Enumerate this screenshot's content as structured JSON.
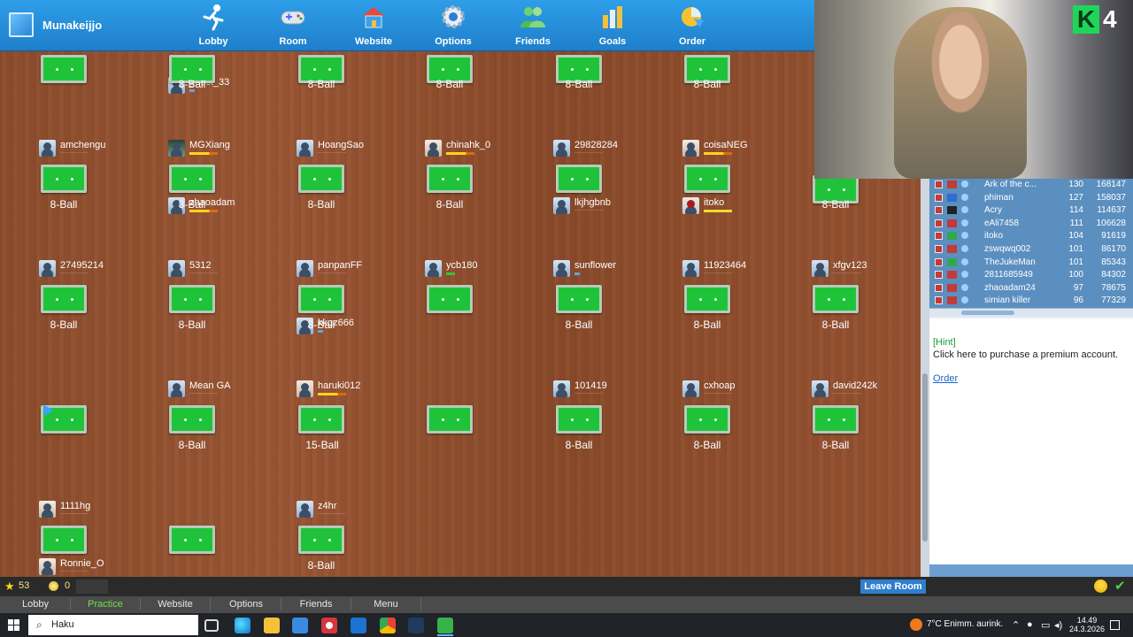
{
  "app": {
    "name": "Munakeijjo"
  },
  "toolbar": [
    {
      "key": "lobby",
      "label": "Lobby",
      "icon": "runner-icon"
    },
    {
      "key": "room",
      "label": "Room",
      "icon": "gamepad-icon"
    },
    {
      "key": "website",
      "label": "Website",
      "icon": "house-icon"
    },
    {
      "key": "options",
      "label": "Options",
      "icon": "gear-icon"
    },
    {
      "key": "friends",
      "label": "Friends",
      "icon": "people-icon"
    },
    {
      "key": "goals",
      "label": "Goals",
      "icon": "bar-chart-icon"
    },
    {
      "key": "order",
      "label": "Order",
      "icon": "pie-chart-icon"
    }
  ],
  "room": {
    "players": [
      {
        "name": "guest_33",
        "bar": "blue"
      },
      {
        "name": "amchengu",
        "bar": "faint"
      },
      {
        "name": "MGXiang",
        "bar": "gold",
        "avatar": "dark"
      },
      {
        "name": "HoangSao",
        "bar": "faint"
      },
      {
        "name": "chinahk_0",
        "bar": "gold",
        "avatar": "photo"
      },
      {
        "name": "29828284",
        "bar": "faint"
      },
      {
        "name": "coisaNEG",
        "bar": "gold",
        "avatar": "photo"
      },
      {
        "name": "zhaoadam",
        "bar": "gold"
      },
      {
        "name": "lkjhgbnb",
        "bar": "faint"
      },
      {
        "name": "itoko",
        "bar": "yellow",
        "avatar": "red"
      },
      {
        "name": "27495214",
        "bar": "faint"
      },
      {
        "name": "5312",
        "bar": "faint"
      },
      {
        "name": "panpanFF",
        "bar": "faint"
      },
      {
        "name": "ycb180",
        "bar": "green"
      },
      {
        "name": "sunflower",
        "bar": "blue"
      },
      {
        "name": "11923464",
        "bar": "faint"
      },
      {
        "name": "xfgv123",
        "bar": "faint"
      },
      {
        "name": "kkgz666",
        "bar": "blue"
      },
      {
        "name": "Mean GA",
        "bar": "faint"
      },
      {
        "name": "haruki012",
        "bar": "gold",
        "avatar": "photo"
      },
      {
        "name": "101419",
        "bar": "faint"
      },
      {
        "name": "cxhoap",
        "bar": "faint"
      },
      {
        "name": "david242k",
        "bar": "faint"
      },
      {
        "name": "1111hg",
        "bar": "faint",
        "avatar": "photo"
      },
      {
        "name": "z4hr",
        "bar": "faint"
      },
      {
        "name": "Ronnie_O",
        "bar": "faint",
        "avatar": "photo"
      }
    ],
    "table_labels": [
      "8-Ball",
      "8-Ball",
      "8-Ball",
      "8-Ball",
      "8-Ball",
      "8-Ball",
      "8-Ball",
      "8-Ball",
      "8-Ball",
      "8-Ball",
      "8-Ball",
      "8-Ball",
      "8-Ball",
      "8-Ball",
      "8-Ball",
      "8-Ball",
      "8-Ball",
      "8-Ball",
      "8-Ball",
      "15-Ball",
      "8-Ball",
      "8-Ball",
      "8-Ball",
      "8-Ball"
    ]
  },
  "webcam": {
    "badge_letter": "K",
    "badge_number": "4"
  },
  "ranking": [
    {
      "name": "Ark of the c...",
      "level": "130",
      "points": "168147"
    },
    {
      "name": "phiman",
      "level": "127",
      "points": "158037"
    },
    {
      "name": "Acry",
      "level": "114",
      "points": "114637"
    },
    {
      "name": "eAli7458",
      "level": "111",
      "points": "106628"
    },
    {
      "name": "itoko",
      "level": "104",
      "points": "91619"
    },
    {
      "name": "zswqwq002",
      "level": "101",
      "points": "86170"
    },
    {
      "name": "TheJukeMan",
      "level": "101",
      "points": "85343"
    },
    {
      "name": "2811685949",
      "level": "100",
      "points": "84302"
    },
    {
      "name": "zhaoadam24",
      "level": "97",
      "points": "78675"
    },
    {
      "name": "simian killer",
      "level": "96",
      "points": "77329"
    }
  ],
  "chat": {
    "hint_title": "[Hint]",
    "hint_text": "Click here to purchase a premium account.",
    "hint_link": "Order"
  },
  "status": {
    "stars": "53",
    "coins": "0",
    "leave_room": "Leave Room"
  },
  "bottom_nav": [
    {
      "label": "Lobby",
      "active": false
    },
    {
      "label": "Practice",
      "active": true
    },
    {
      "label": "Website",
      "active": false
    },
    {
      "label": "Options",
      "active": false
    },
    {
      "label": "Friends",
      "active": false
    },
    {
      "label": "Menu",
      "active": false
    }
  ],
  "taskbar": {
    "search_placeholder": "Haku",
    "weather": "7°C  Enimm. aurink.",
    "time": "14.49",
    "date": "24.3.2026"
  }
}
